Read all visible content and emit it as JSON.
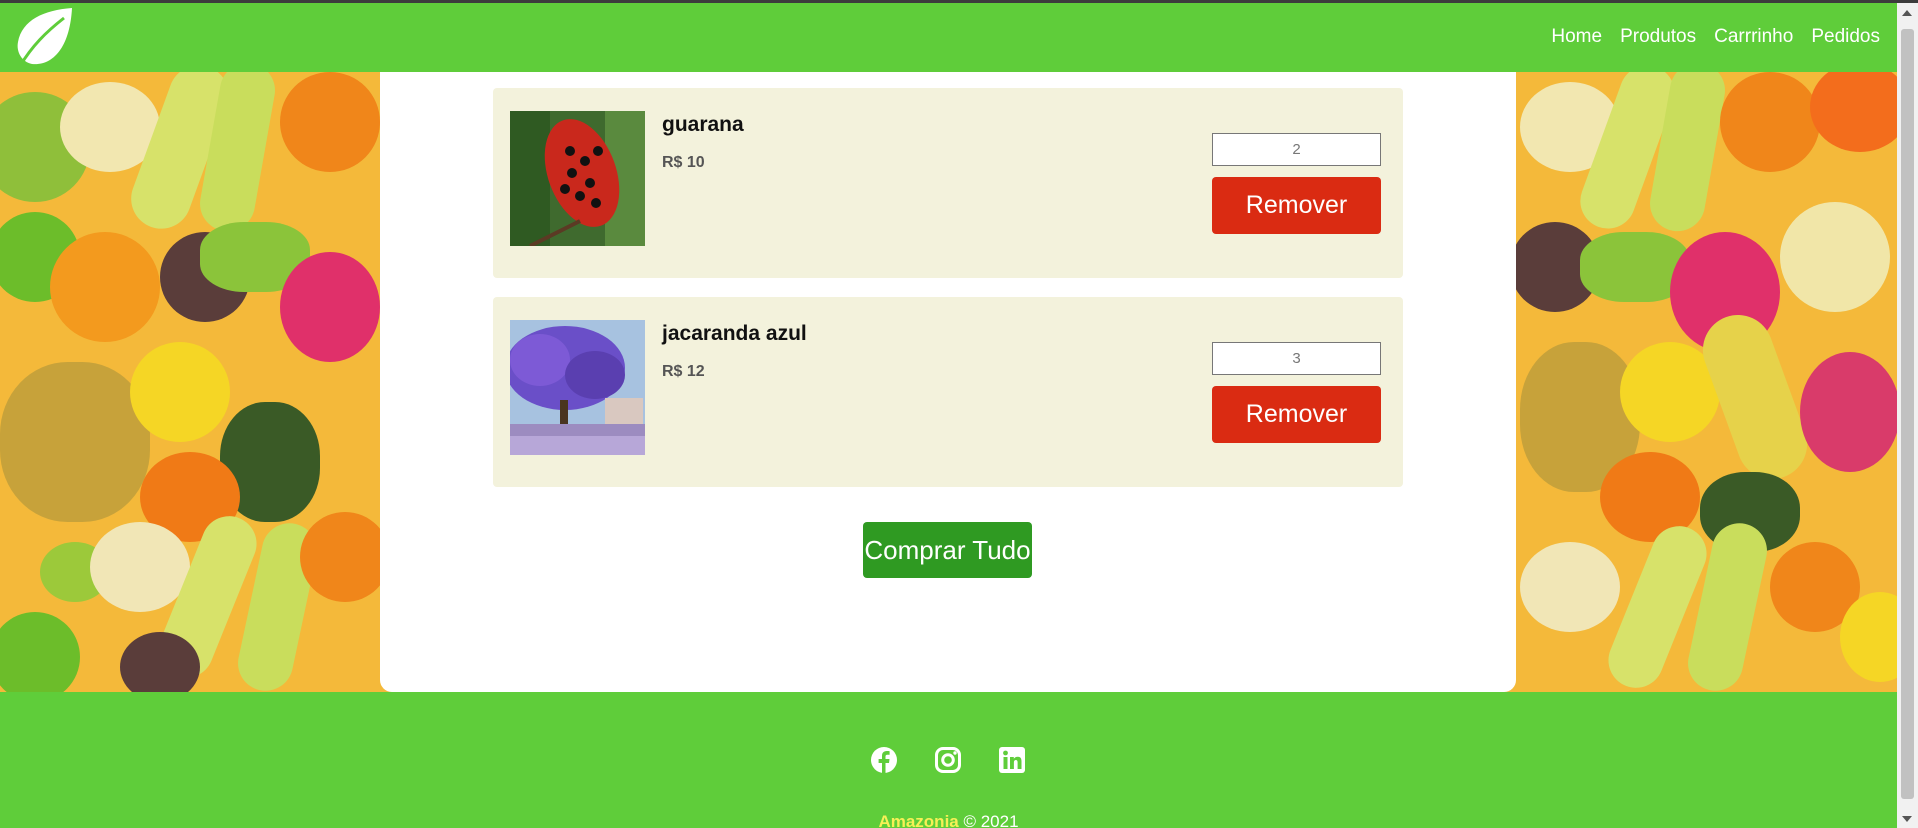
{
  "header": {
    "logo_icon": "leaf-icon",
    "nav": [
      "Home",
      "Produtos",
      "Carrrinho",
      "Pedidos"
    ]
  },
  "cart": {
    "items": [
      {
        "name": "guarana",
        "price": "R$ 10",
        "quantity": "2",
        "remove_label": "Remover",
        "image": "guarana-fruit-photo"
      },
      {
        "name": "jacaranda azul",
        "price": "R$ 12",
        "quantity": "3",
        "remove_label": "Remover",
        "image": "jacaranda-tree-photo"
      }
    ],
    "buy_all_label": "Comprar Tudo"
  },
  "footer": {
    "socials": [
      "facebook-icon",
      "instagram-icon",
      "linkedin-icon"
    ],
    "brand": "Amazonia",
    "copyright_suffix": " © 2021"
  },
  "colors": {
    "brand_green": "#5fcd3a",
    "remove_red": "#da2b12",
    "buy_green": "#2f9a22",
    "item_bg": "#f3f2dc"
  }
}
